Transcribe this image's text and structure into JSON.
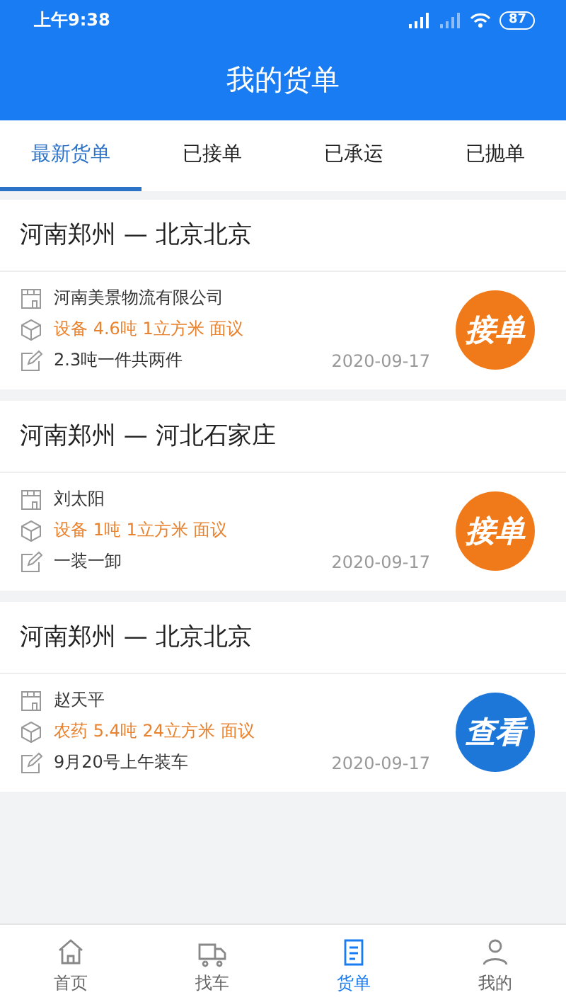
{
  "status_bar": {
    "time": "上午9:38",
    "battery": "87"
  },
  "header": {
    "title": "我的货单"
  },
  "tabs": [
    {
      "label": "最新货单",
      "selected": true
    },
    {
      "label": "已接单",
      "selected": false
    },
    {
      "label": "已承运",
      "selected": false
    },
    {
      "label": "已抛单",
      "selected": false
    }
  ],
  "orders": [
    {
      "route": "河南郑州 — 北京北京",
      "shipper": "河南美景物流有限公司",
      "cargo": "设备 4.6吨 1立方米 面议",
      "note": "2.3吨一件共两件",
      "date": "2020-09-17",
      "action": {
        "label": "接单",
        "kind": "accept"
      }
    },
    {
      "route": "河南郑州 — 河北石家庄",
      "shipper": "刘太阳",
      "cargo": "设备 1吨 1立方米 面议",
      "note": "一装一卸",
      "date": "2020-09-17",
      "action": {
        "label": "接单",
        "kind": "accept"
      }
    },
    {
      "route": "河南郑州 — 北京北京",
      "shipper": "赵天平",
      "cargo": "农药 5.4吨 24立方米 面议",
      "note": "9月20号上午装车",
      "date": "2020-09-17",
      "action": {
        "label": "查看",
        "kind": "view"
      }
    }
  ],
  "bottom_nav": [
    {
      "label": "首页",
      "kind": "home",
      "selected": false
    },
    {
      "label": "找车",
      "kind": "truck",
      "selected": false
    },
    {
      "label": "货单",
      "kind": "orders",
      "selected": true
    },
    {
      "label": "我的",
      "kind": "profile",
      "selected": false
    }
  ]
}
